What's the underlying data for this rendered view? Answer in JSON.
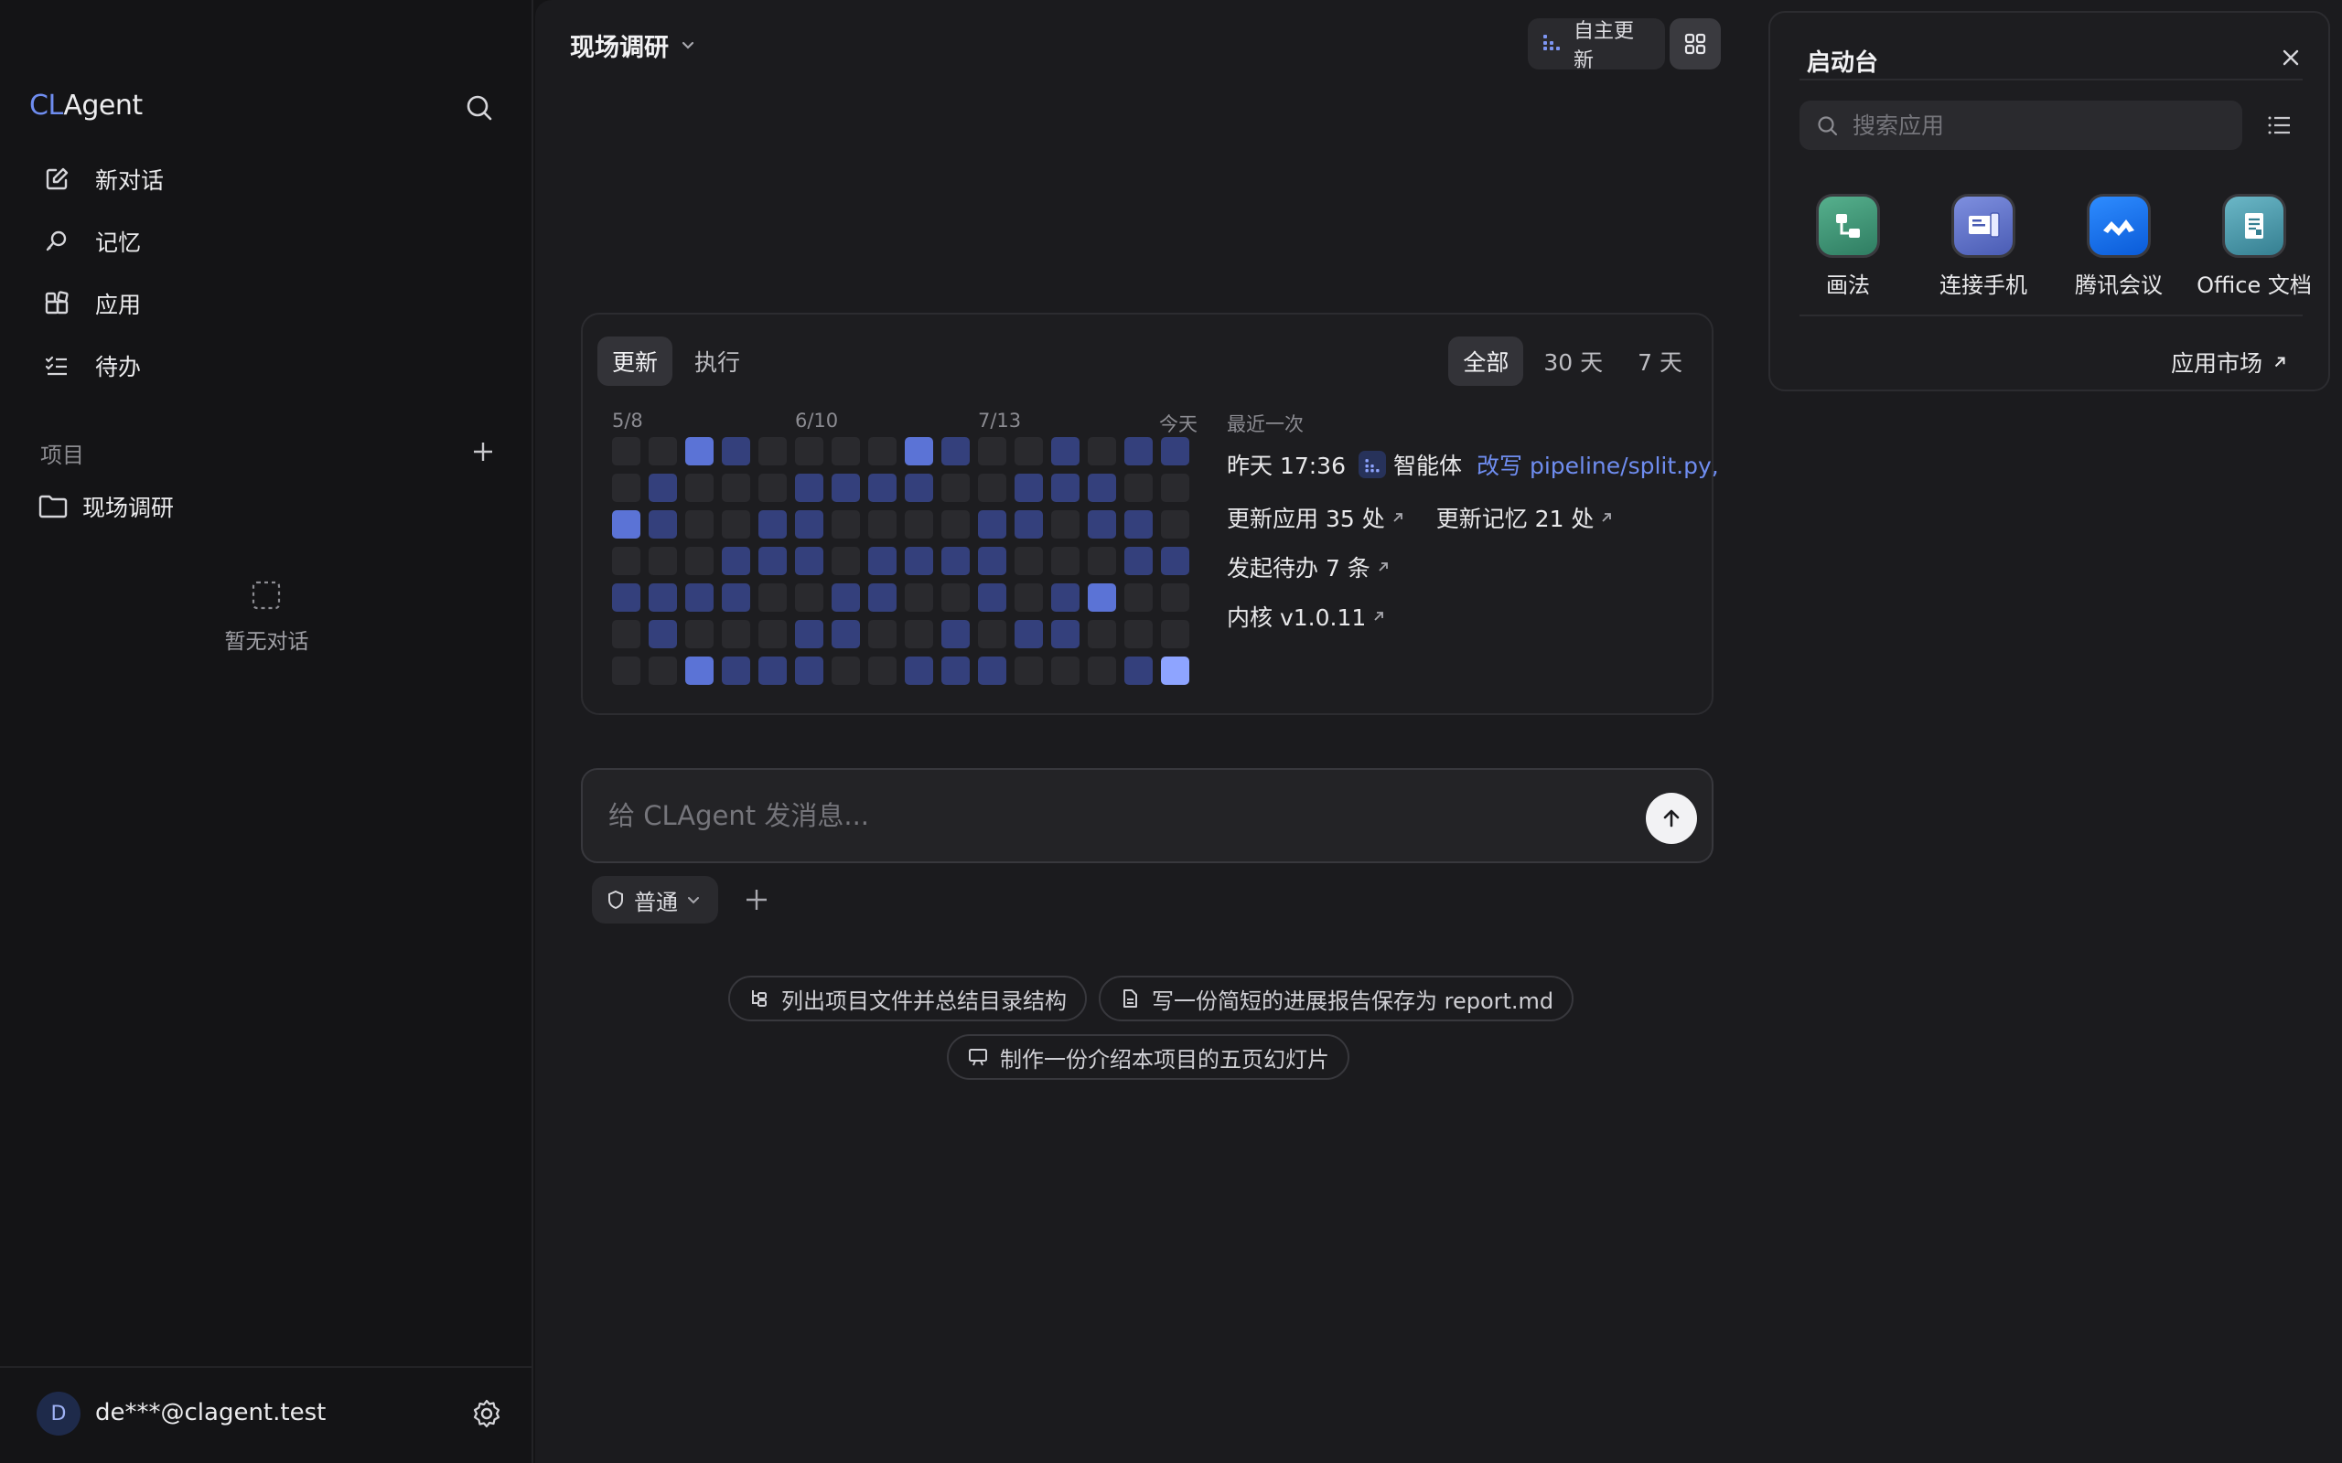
{
  "sidebar": {
    "logo_prefix": "CL",
    "logo_suffix": "Agent",
    "nav": [
      {
        "label": "新对话",
        "icon": "edit-icon"
      },
      {
        "label": "记忆",
        "icon": "memory-icon"
      },
      {
        "label": "应用",
        "icon": "apps-icon"
      },
      {
        "label": "待办",
        "icon": "todo-icon"
      }
    ],
    "section_title": "项目",
    "project_name": "现场调研",
    "empty_text": "暂无对话",
    "user_initial": "D",
    "user_email": "de***@clagent.test"
  },
  "header": {
    "project_title": "现场调研",
    "auto_update_label": "自主更新"
  },
  "activity": {
    "tabs": [
      "更新",
      "执行"
    ],
    "active_tab": "更新",
    "ranges": [
      "全部",
      "30 天",
      "7 天"
    ],
    "active_range": "全部",
    "month_labels": [
      "5/8",
      "6/10",
      "7/13",
      "今天"
    ],
    "heatmap_levels": [
      [
        0,
        0,
        3,
        2,
        0,
        0,
        0,
        0,
        3,
        2,
        0,
        0,
        2,
        0,
        2,
        2
      ],
      [
        0,
        2,
        0,
        0,
        0,
        2,
        2,
        2,
        2,
        0,
        0,
        2,
        2,
        2,
        0,
        0
      ],
      [
        3,
        2,
        0,
        0,
        2,
        2,
        0,
        0,
        0,
        0,
        2,
        2,
        0,
        2,
        2,
        0
      ],
      [
        0,
        0,
        0,
        2,
        2,
        2,
        0,
        2,
        2,
        2,
        2,
        0,
        0,
        0,
        2,
        2
      ],
      [
        2,
        2,
        2,
        2,
        0,
        0,
        2,
        2,
        0,
        0,
        2,
        0,
        2,
        3,
        0,
        0
      ],
      [
        0,
        2,
        0,
        0,
        0,
        2,
        2,
        0,
        0,
        2,
        0,
        2,
        2,
        0,
        0,
        0
      ],
      [
        0,
        0,
        3,
        2,
        2,
        2,
        0,
        0,
        2,
        2,
        2,
        0,
        0,
        0,
        2,
        4
      ]
    ],
    "heat_colors": [
      "#2a2a2e",
      "#2c3566",
      "#34407c",
      "#5b73d6",
      "#8ea4ff"
    ],
    "recent_label": "最近一次",
    "recent_time": "昨天 17:36",
    "recent_agent": "智能体",
    "recent_action": "改写 pipeline/split.py,",
    "stats": [
      {
        "label": "更新应用 35 处"
      },
      {
        "label": "更新记忆 21 处"
      },
      {
        "label": "发起待办 7 条"
      },
      {
        "label": "内核 v1.0.11"
      }
    ]
  },
  "composer": {
    "placeholder": "给 CLAgent 发消息...",
    "mode_label": "普通"
  },
  "suggestions": [
    {
      "label": "列出项目文件并总结目录结构",
      "icon": "tree-icon"
    },
    {
      "label": "写一份简短的进展报告保存为 report.md",
      "icon": "document-icon"
    },
    {
      "label": "制作一份介绍本项目的五页幻灯片",
      "icon": "slides-icon"
    }
  ],
  "launchpad": {
    "title": "启动台",
    "search_placeholder": "搜索应用",
    "apps": [
      {
        "name": "画法",
        "icon": "flow-icon"
      },
      {
        "name": "连接手机",
        "icon": "phone-connect-icon"
      },
      {
        "name": "腾讯会议",
        "icon": "meeting-icon"
      },
      {
        "name": "Office 文档",
        "icon": "office-doc-icon"
      }
    ],
    "market_label": "应用市场"
  }
}
